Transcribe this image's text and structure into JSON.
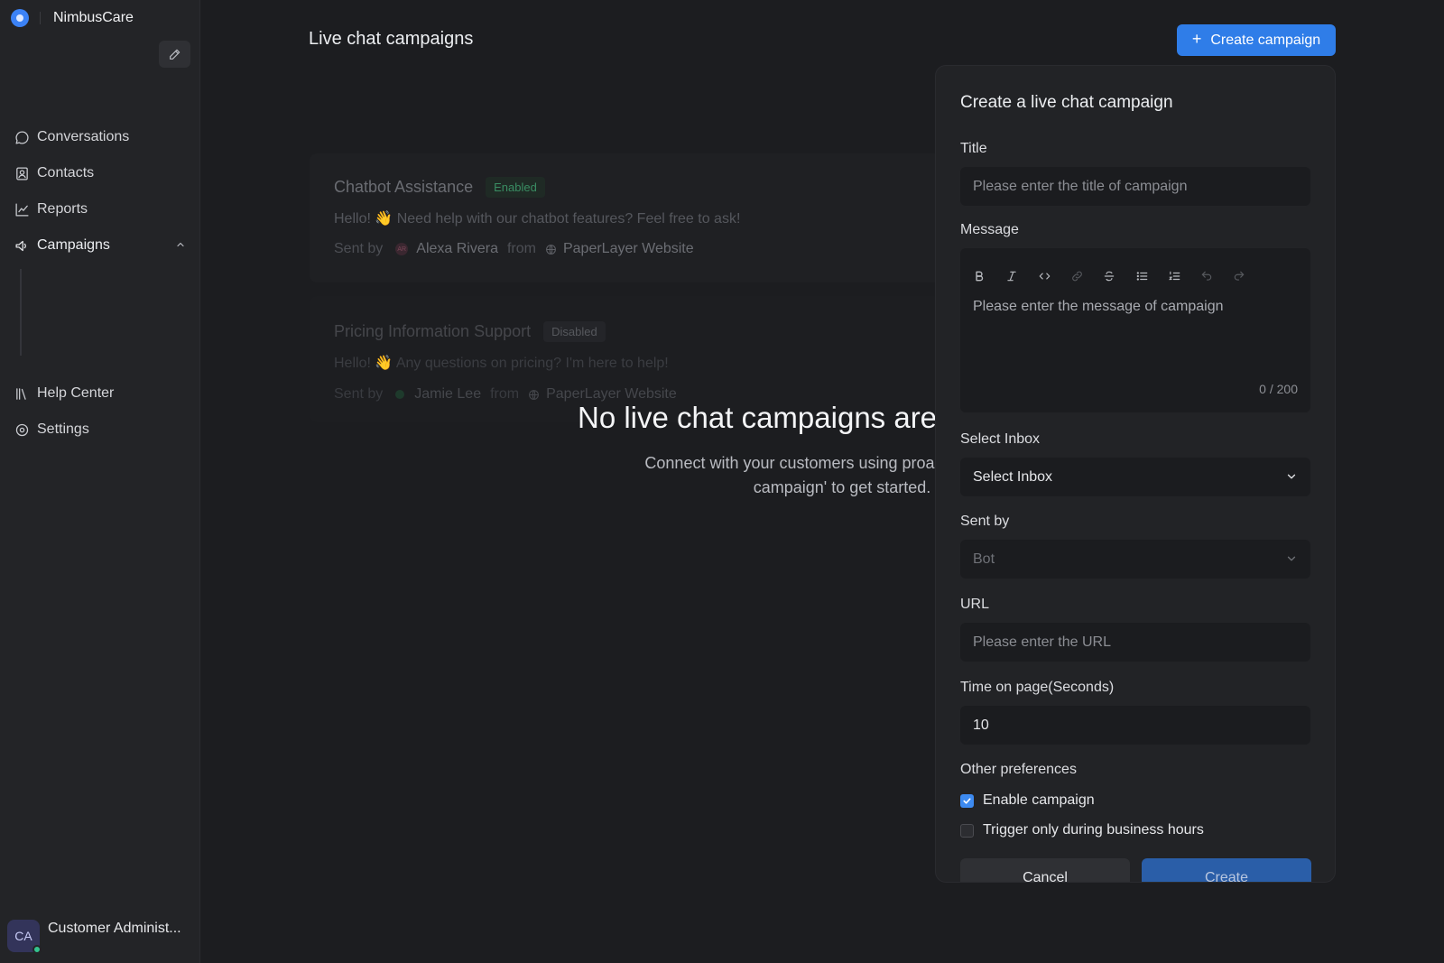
{
  "app": {
    "name": "NimbusCare"
  },
  "sidebar": {
    "items": [
      {
        "label": "Conversations",
        "icon": "chat-bubble-icon"
      },
      {
        "label": "Contacts",
        "icon": "contact-card-icon"
      },
      {
        "label": "Reports",
        "icon": "chart-line-icon"
      },
      {
        "label": "Campaigns",
        "icon": "megaphone-icon"
      },
      {
        "label": "Help Center",
        "icon": "library-icon"
      },
      {
        "label": "Settings",
        "icon": "gear-icon"
      }
    ],
    "profile": {
      "initials": "CA",
      "name": "Customer Administ..."
    }
  },
  "header": {
    "title": "Live chat campaigns",
    "create_button": "Create campaign"
  },
  "background_cards": [
    {
      "title": "Chatbot Assistance",
      "status": "Enabled",
      "message": "Hello! 👋 Need help with our chatbot features? Feel free to ask!",
      "sent_by_label": "Sent by",
      "sender": "Alexa Rivera",
      "sender_initials": "AR",
      "from_label": "from",
      "inbox": "PaperLayer Website"
    },
    {
      "title": "Pricing Information Support",
      "status": "Disabled",
      "message": "Hello! 👋 Any questions on pricing? I'm here to help!",
      "sent_by_label": "Sent by",
      "sender": "Jamie Lee",
      "from_label": "from",
      "inbox": "PaperLayer Website"
    }
  ],
  "empty_state": {
    "title": "No live chat campaigns are",
    "description_line1": "Connect with your customers using proactive mes",
    "description_line2": "campaign' to get started."
  },
  "modal": {
    "title": "Create a live chat campaign",
    "title_label": "Title",
    "title_placeholder": "Please enter the title of campaign",
    "message_label": "Message",
    "message_placeholder": "Please enter the message of campaign",
    "message_counter": "0 / 200",
    "inbox_label": "Select Inbox",
    "inbox_value": "Select Inbox",
    "sent_by_label": "Sent by",
    "sent_by_value": "Bot",
    "url_label": "URL",
    "url_placeholder": "Please enter the URL",
    "time_label": "Time on page(Seconds)",
    "time_value": "10",
    "prefs_label": "Other preferences",
    "enable_campaign": "Enable campaign",
    "business_hours": "Trigger only during business hours",
    "cancel": "Cancel",
    "create": "Create"
  },
  "colors": {
    "accent": "#2f7de8",
    "background": "#1c1d20",
    "sidebar": "#232427",
    "modal": "#222326"
  }
}
